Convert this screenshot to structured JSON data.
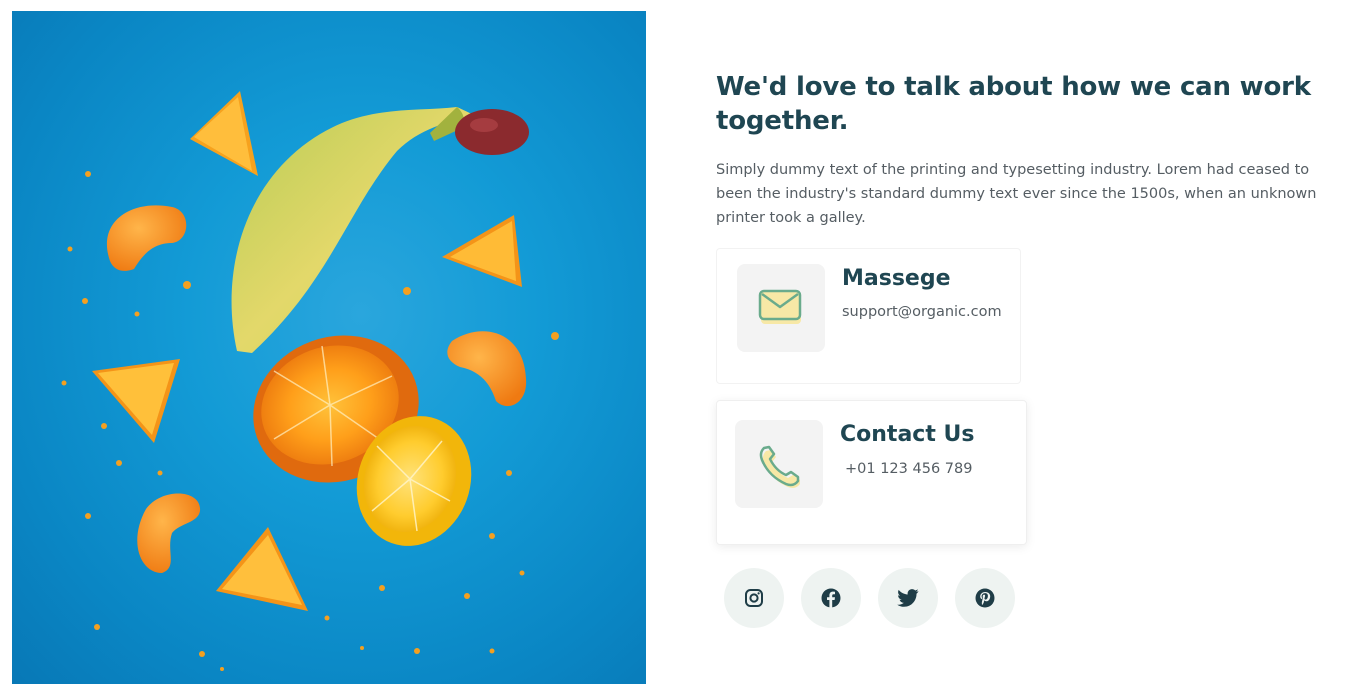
{
  "heading": "We'd love to talk about how we can work together.",
  "description": "Simply dummy text of the printing and typesetting industry. Lorem had ceased to been the industry's standard dummy text ever since the 1500s, when an unknown printer took a galley.",
  "cards": {
    "message": {
      "title": "Massege",
      "value": "support@organic.com",
      "icon": "envelope-icon"
    },
    "contact": {
      "title": "Contact Us",
      "value": "+01 123 456 789",
      "icon": "phone-icon"
    }
  },
  "socials": [
    {
      "name": "instagram",
      "icon": "instagram-icon"
    },
    {
      "name": "facebook",
      "icon": "facebook-icon"
    },
    {
      "name": "twitter",
      "icon": "twitter-icon"
    },
    {
      "name": "pinterest",
      "icon": "pinterest-icon"
    }
  ],
  "colors": {
    "heading": "#1f4652",
    "body_text": "#555d63",
    "hero_background": "#139bd6",
    "social_background": "#eef3f1",
    "icon_box": "#f3f3f3",
    "icon_stroke": "#6aab8c",
    "icon_fill": "#f7e8a6"
  }
}
